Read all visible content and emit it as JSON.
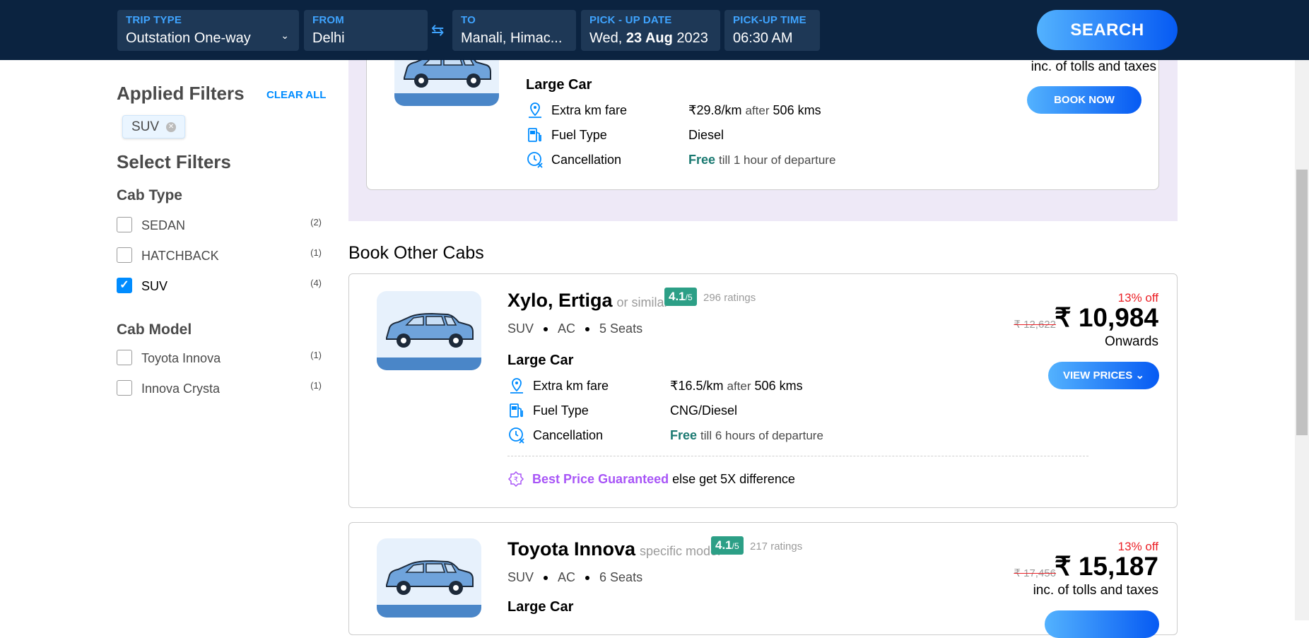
{
  "search_bar": {
    "trip_type": {
      "label": "TRIP TYPE",
      "value": "Outstation One-way"
    },
    "from": {
      "label": "FROM",
      "value": "Delhi"
    },
    "to": {
      "label": "TO",
      "value": "Manali, Himac..."
    },
    "pickup_date": {
      "label": "PICK - UP DATE",
      "day": "Wed,",
      "date": "23 Aug",
      "year": "2023"
    },
    "pickup_time": {
      "label": "PICK-UP TIME",
      "value": "06:30 AM"
    },
    "search_label": "SEARCH"
  },
  "sidebar": {
    "applied_filters_title": "Applied Filters",
    "clear_all": "CLEAR ALL",
    "applied_chip": "SUV",
    "select_filters_title": "Select Filters",
    "cab_type_title": "Cab Type",
    "cab_types": [
      {
        "label": "SEDAN",
        "count": "(2)",
        "checked": false
      },
      {
        "label": "HATCHBACK",
        "count": "(1)",
        "checked": false
      },
      {
        "label": "SUV",
        "count": "(4)",
        "checked": true
      }
    ],
    "cab_model_title": "Cab Model",
    "cab_models": [
      {
        "label": "Toyota Innova",
        "count": "(1)",
        "checked": false
      },
      {
        "label": "Innova Crysta",
        "count": "(1)",
        "checked": false
      }
    ]
  },
  "selected_card": {
    "category": "Large Car",
    "tax_note": "inc. of tolls and taxes",
    "book_now": "BOOK NOW",
    "rows": [
      {
        "key": "Extra km fare",
        "value": "₹29.8/km",
        "after": "after",
        "kms": "506 kms"
      },
      {
        "key": "Fuel Type",
        "value": "Diesel"
      },
      {
        "key": "Cancellation",
        "free": "Free",
        "rest": "till 1 hour of departure"
      }
    ]
  },
  "other_cabs_title": "Book Other Cabs",
  "cards": [
    {
      "title": "Xylo, Ertiga",
      "similar": "or similar",
      "rating": "4.1",
      "rating_of": "/5",
      "ratings": "296 ratings",
      "specs": [
        "SUV",
        "AC",
        "5 Seats"
      ],
      "category": "Large Car",
      "extra_fare": "₹16.5/km",
      "after": "after",
      "kms": "506 kms",
      "fuel": "CNG/Diesel",
      "free": "Free",
      "cancel_rest": "till 6 hours of departure",
      "discount": "13% off",
      "old_price": "₹ 12,622",
      "price": "₹ 10,984",
      "price_note": "Onwards",
      "action": "VIEW PRICES",
      "bpg": "Best Price Guaranteed",
      "bpg_rest": "else get 5X difference",
      "labels": {
        "extra": "Extra km fare",
        "fuel": "Fuel Type",
        "cancel": "Cancellation"
      }
    },
    {
      "title": "Toyota Innova",
      "similar": "specific model",
      "rating": "4.1",
      "rating_of": "/5",
      "ratings": "217 ratings",
      "specs": [
        "SUV",
        "AC",
        "6 Seats"
      ],
      "category": "Large Car",
      "discount": "13% off",
      "old_price": "₹ 17,456",
      "price": "₹ 15,187",
      "price_note": "inc. of tolls and taxes"
    }
  ],
  "colors": {
    "nav_bg": "#0b2340",
    "accent_blue": "#008cff",
    "rating_green": "#2c9f86",
    "discount_red": "#eb2026",
    "bpg_purple": "#a855f7"
  }
}
